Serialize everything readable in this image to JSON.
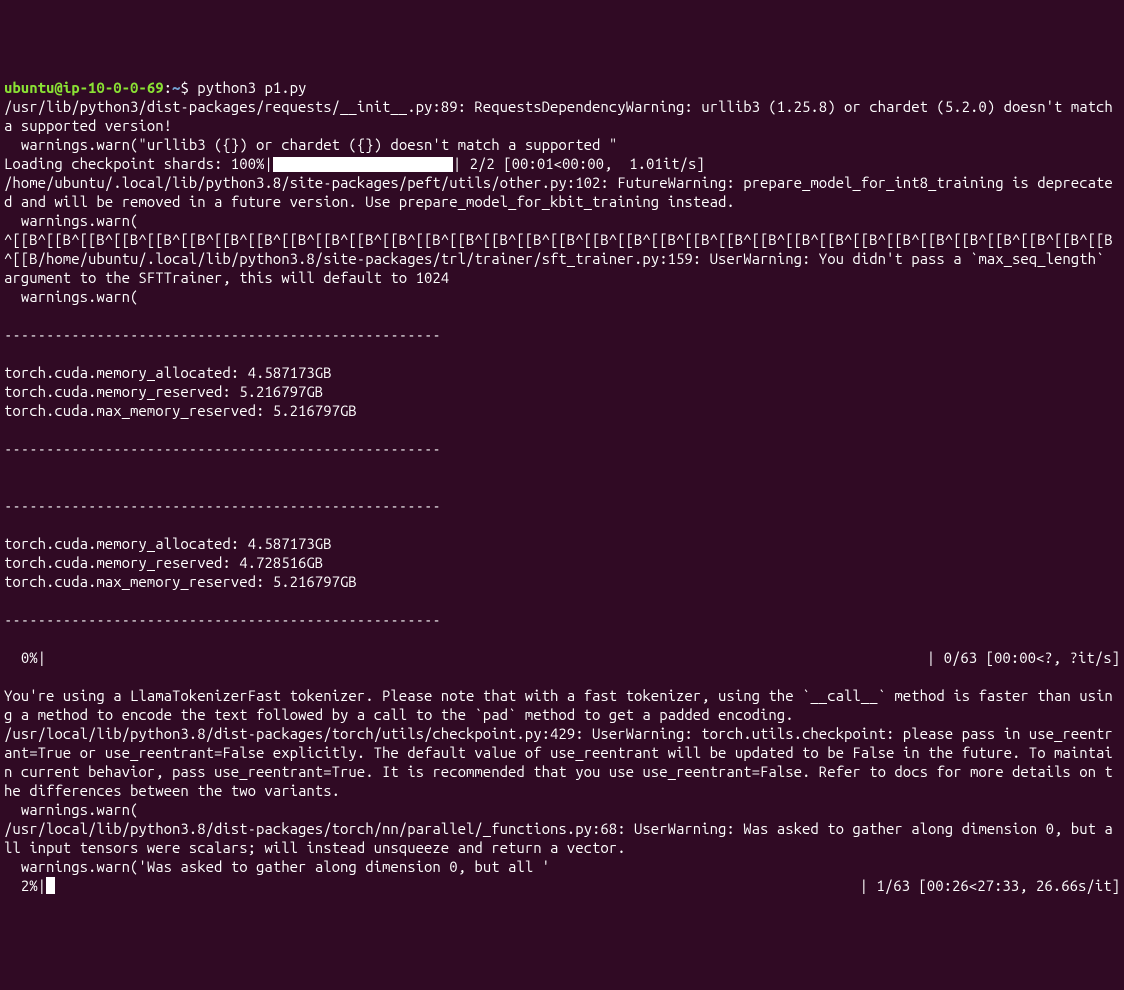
{
  "prompt": {
    "user": "ubuntu",
    "at": "@",
    "host": "ip-10-0-0-69",
    "colon": ":",
    "path": "~",
    "dollar": "$ ",
    "command": "python3 p1.py"
  },
  "lines": {
    "l01": "/usr/lib/python3/dist-packages/requests/__init__.py:89: RequestsDependencyWarning: urllib3 (1.25.8) or chardet (5.2.0) doesn't match a supported version!",
    "l02": "  warnings.warn(\"urllib3 ({}) or chardet ({}) doesn't match a supported \"",
    "l03a": "Loading checkpoint shards: 100%|",
    "l03b": "| 2/2 [00:01<00:00,  1.01it/s]",
    "l04": "/home/ubuntu/.local/lib/python3.8/site-packages/peft/utils/other.py:102: FutureWarning: prepare_model_for_int8_training is deprecated and will be removed in a future version. Use prepare_model_for_kbit_training instead.",
    "l05": "  warnings.warn(",
    "l06": "^[[B^[[B^[[B^[[B^[[B^[[B^[[B^[[B^[[B^[[B^[[B^[[B^[[B^[[B^[[B^[[B^[[B^[[B^[[B^[[B^[[B^[[B^[[B^[[B^[[B^[[B^[[B^[[B^[[B^[[B^[[B^[[B^[[B^[[B/home/ubuntu/.local/lib/python3.8/site-packages/trl/trainer/sft_trainer.py:159: UserWarning: You didn't pass a `max_seq_length` argument to the SFTTrainer, this will default to 1024",
    "l07": "  warnings.warn(",
    "l08": "",
    "dash": "----------------------------------------------------",
    "l10": "",
    "l11": "torch.cuda.memory_allocated: 4.587173GB",
    "l12": "torch.cuda.memory_reserved: 5.216797GB",
    "l13": "torch.cuda.max_memory_reserved: 5.216797GB",
    "l14": "",
    "l21": "torch.cuda.memory_allocated: 4.587173GB",
    "l22": "torch.cuda.memory_reserved: 4.728516GB",
    "l23": "torch.cuda.max_memory_reserved: 5.216797GB",
    "l30a": "  0%|          ",
    "l30b": "| 0/63 [00:00<?, ?it/s]",
    "l31": "You're using a LlamaTokenizerFast tokenizer. Please note that with a fast tokenizer, using the `__call__` method is faster than using a method to encode the text followed by a call to the `pad` method to get a padded encoding.",
    "l32": "/usr/local/lib/python3.8/dist-packages/torch/utils/checkpoint.py:429: UserWarning: torch.utils.checkpoint: please pass in use_reentrant=True or use_reentrant=False explicitly. The default value of use_reentrant will be updated to be False in the future. To maintain current behavior, pass use_reentrant=True. It is recommended that you use use_reentrant=False. Refer to docs for more details on the differences between the two variants.",
    "l33": "  warnings.warn(",
    "l34": "/usr/local/lib/python3.8/dist-packages/torch/nn/parallel/_functions.py:68: UserWarning: Was asked to gather along dimension 0, but all input tensors were scalars; will instead unsqueeze and return a vector.",
    "l35": "  warnings.warn('Was asked to gather along dimension 0, but all '",
    "l36a": "  2%|",
    "l36b": "| 1/63 [00:26<27:33, 26.66s/it]"
  }
}
